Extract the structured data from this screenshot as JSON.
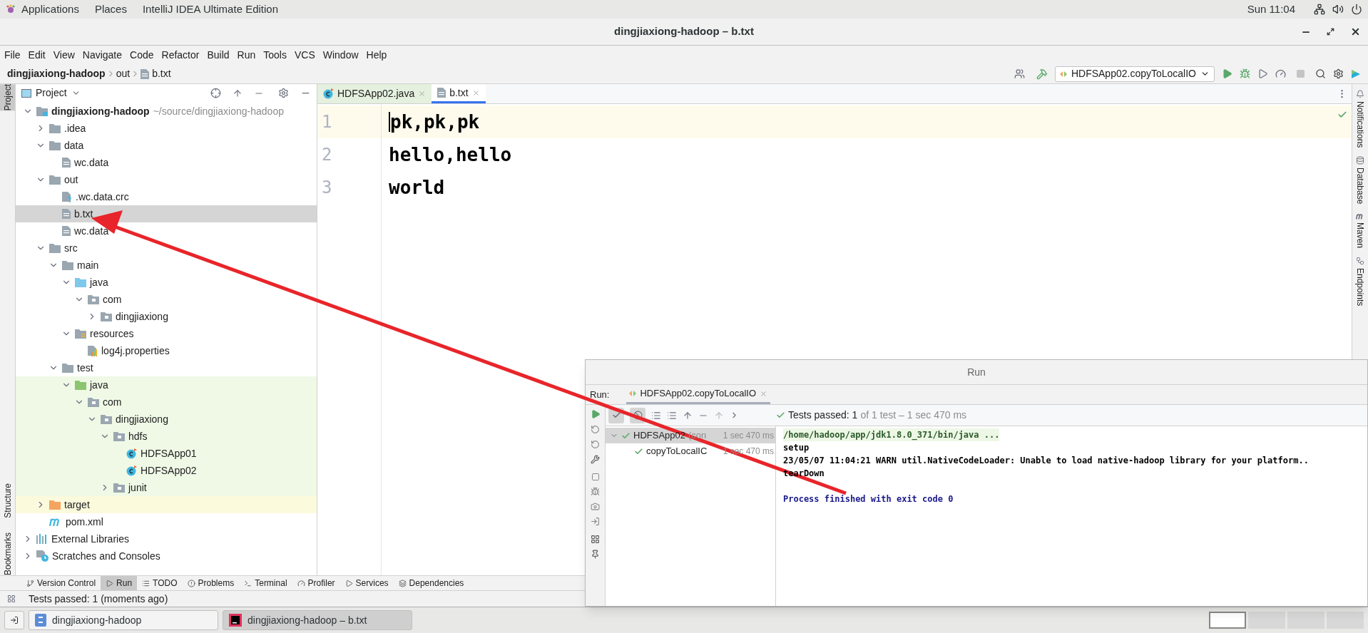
{
  "system_bar": {
    "menus": [
      "Applications",
      "Places",
      "IntelliJ IDEA Ultimate Edition"
    ],
    "clock": "Sun 11:04"
  },
  "window": {
    "title": "dingjiaxiong-hadoop – b.txt"
  },
  "menu_bar": [
    "File",
    "Edit",
    "View",
    "Navigate",
    "Code",
    "Refactor",
    "Build",
    "Run",
    "Tools",
    "VCS",
    "Window",
    "Help"
  ],
  "breadcrumb": [
    {
      "label": "dingjiaxiong-hadoop",
      "kind": "project"
    },
    {
      "label": "out",
      "kind": "folder"
    },
    {
      "label": "b.txt",
      "kind": "file"
    }
  ],
  "run_config": "HDFSApp02.copyToLocalIO",
  "left_tool_strip": [
    {
      "label": "Project",
      "selected": true
    },
    {
      "label": "Structure",
      "selected": false
    },
    {
      "label": "Bookmarks",
      "selected": false
    }
  ],
  "right_tool_strip": [
    "Notifications",
    "Database",
    "Maven",
    "Endpoints"
  ],
  "project_panel": {
    "title": "Project",
    "tree": [
      {
        "label": "dingjiaxiong-hadoop",
        "hint": "~/source/dingjiaxiong-hadoop",
        "kind": "module",
        "expanded": true,
        "selected": false,
        "children": [
          {
            "label": ".idea",
            "kind": "folder",
            "expanded": false,
            "selected": false
          },
          {
            "label": "data",
            "kind": "folder",
            "expanded": true,
            "selected": false,
            "children": [
              {
                "label": "wc.data",
                "kind": "file",
                "selected": false
              }
            ]
          },
          {
            "label": "out",
            "kind": "folder",
            "expanded": true,
            "selected": false,
            "children": [
              {
                "label": ".wc.data.crc",
                "kind": "unknown-file",
                "selected": false
              },
              {
                "label": "b.txt",
                "kind": "file",
                "selected": true
              },
              {
                "label": "wc.data",
                "kind": "file",
                "selected": false
              }
            ]
          },
          {
            "label": "src",
            "kind": "folder",
            "expanded": true,
            "selected": false,
            "children": [
              {
                "label": "main",
                "kind": "folder",
                "expanded": true,
                "selected": false,
                "children": [
                  {
                    "label": "java",
                    "kind": "source-folder",
                    "expanded": true,
                    "selected": false,
                    "children": [
                      {
                        "label": "com",
                        "kind": "package",
                        "expanded": true,
                        "selected": false,
                        "children": [
                          {
                            "label": "dingjiaxiong",
                            "kind": "package",
                            "expanded": false,
                            "selected": false
                          }
                        ]
                      }
                    ]
                  },
                  {
                    "label": "resources",
                    "kind": "resources-folder",
                    "expanded": true,
                    "selected": false,
                    "children": [
                      {
                        "label": "log4j.properties",
                        "kind": "properties",
                        "selected": false
                      }
                    ]
                  }
                ]
              },
              {
                "label": "test",
                "kind": "folder",
                "expanded": true,
                "selected": false,
                "children": [
                  {
                    "label": "java",
                    "kind": "test-folder",
                    "test_sources": true,
                    "expanded": true,
                    "selected": false,
                    "children": [
                      {
                        "label": "com",
                        "kind": "package",
                        "expanded": true,
                        "selected": false,
                        "children": [
                          {
                            "label": "dingjiaxiong",
                            "kind": "package",
                            "expanded": true,
                            "selected": false,
                            "children": [
                              {
                                "label": "hdfs",
                                "kind": "package",
                                "expanded": true,
                                "selected": false,
                                "children": [
                                  {
                                    "label": "HDFSApp01",
                                    "kind": "class",
                                    "selected": false
                                  },
                                  {
                                    "label": "HDFSApp02",
                                    "kind": "class",
                                    "selected": false
                                  }
                                ]
                              },
                              {
                                "label": "junit",
                                "kind": "package",
                                "expanded": false,
                                "selected": false
                              }
                            ]
                          }
                        ]
                      }
                    ]
                  }
                ]
              }
            ]
          },
          {
            "label": "target",
            "kind": "excluded-folder",
            "excluded": true,
            "expanded": false,
            "selected": false
          },
          {
            "label": "pom.xml",
            "kind": "maven",
            "selected": false
          }
        ]
      },
      {
        "label": "External Libraries",
        "kind": "libraries",
        "expanded": false,
        "selected": false
      },
      {
        "label": "Scratches and Consoles",
        "kind": "scratches",
        "expanded": false,
        "selected": false
      }
    ]
  },
  "editor": {
    "tabs": [
      {
        "label": "HDFSApp02.java",
        "kind": "class",
        "selected": false
      },
      {
        "label": "b.txt",
        "kind": "file",
        "selected": true
      }
    ],
    "lines": [
      {
        "number": "1",
        "text": "pk,pk,pk",
        "current": true
      },
      {
        "number": "2",
        "text": "hello,hello",
        "current": false
      },
      {
        "number": "3",
        "text": "world",
        "current": false
      }
    ]
  },
  "run_window": {
    "title": "Run",
    "label": "Run:",
    "tab": "HDFSApp02.copyToLocalIO",
    "status": {
      "label": "Tests passed:",
      "count": "1",
      "detail": "of 1 test – 1 sec 470 ms"
    },
    "tests": [
      {
        "label": "HDFSApp02",
        "hint": "(con",
        "time": "1 sec 470 ms",
        "selected": true,
        "children": [
          {
            "label": "copyToLocalIC",
            "time": "1 sec 470 ms",
            "selected": false
          }
        ]
      }
    ],
    "console": [
      {
        "kind": "command",
        "text": "/home/hadoop/app/jdk1.8.0_371/bin/java ..."
      },
      {
        "kind": "output",
        "text": "setup"
      },
      {
        "kind": "output",
        "text": "23/05/07 11:04:21 WARN util.NativeCodeLoader: Unable to load native-hadoop library for your platform.."
      },
      {
        "kind": "output",
        "text": "tearDown"
      },
      {
        "kind": "blank"
      },
      {
        "kind": "exit",
        "text": "Process finished with exit code 0"
      }
    ]
  },
  "tool_window_bar": [
    {
      "label": "Version Control",
      "selected": false
    },
    {
      "label": "Run",
      "selected": true
    },
    {
      "label": "TODO",
      "selected": false
    },
    {
      "label": "Problems",
      "selected": false
    },
    {
      "label": "Terminal",
      "selected": false
    },
    {
      "label": "Profiler",
      "selected": false
    },
    {
      "label": "Services",
      "selected": false
    },
    {
      "label": "Dependencies",
      "selected": false
    }
  ],
  "status_bar": "Tests passed: 1 (moments ago)",
  "taskbar": [
    {
      "label": "dingjiaxiong-hadoop",
      "kind": "files",
      "selected": false
    },
    {
      "label": "dingjiaxiong-hadoop – b.txt",
      "kind": "ide",
      "selected": true
    }
  ]
}
